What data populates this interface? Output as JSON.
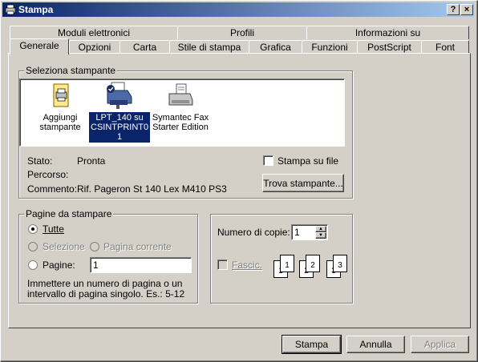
{
  "window": {
    "title": "Stampa",
    "help_button": "?",
    "close_button": "×"
  },
  "tabs_back": [
    "Moduli elettronici",
    "Profili",
    "Informazioni su"
  ],
  "tabs_front": [
    "Generale",
    "Opzioni",
    "Carta",
    "Stile di stampa",
    "Grafica",
    "Funzioni",
    "PostScript",
    "Font"
  ],
  "select_printer": {
    "legend": "Seleziona stampante",
    "printers": [
      {
        "line1": "Aggiungi",
        "line2": "stampante",
        "line3": "",
        "icon": "add-printer-icon"
      },
      {
        "line1": "LPT_140 su",
        "line2": "CSINTPRINT0",
        "line3": "1",
        "icon": "network-printer-icon"
      },
      {
        "line1": "Symantec Fax",
        "line2": "Starter Edition",
        "line3": "",
        "icon": "fax-printer-icon"
      }
    ],
    "status_label": "Stato:",
    "status_value": "Pronta",
    "path_label": "Percorso:",
    "path_value": "",
    "comment_label": "Commento:",
    "comment_value": "Rif. Pageron St 140  Lex M410 PS3",
    "print_to_file": "Stampa su file",
    "find_printer": "Trova stampante..."
  },
  "page_range": {
    "legend": "Pagine da stampare",
    "all": "Tutte",
    "selection": "Selezione",
    "current_page": "Pagina corrente",
    "pages": "Pagine:",
    "pages_value": "1",
    "hint_line1": "Immettere un numero di pagina o un",
    "hint_line2": "intervallo di pagina singolo. Es.: 5-12"
  },
  "copies": {
    "label": "Numero di copie:",
    "value": "1",
    "collate": "Fascic.",
    "collate_pages": [
      "1",
      "1",
      "2",
      "2",
      "3",
      "3"
    ]
  },
  "buttons": {
    "print": "Stampa",
    "cancel": "Annulla",
    "apply": "Applica"
  }
}
